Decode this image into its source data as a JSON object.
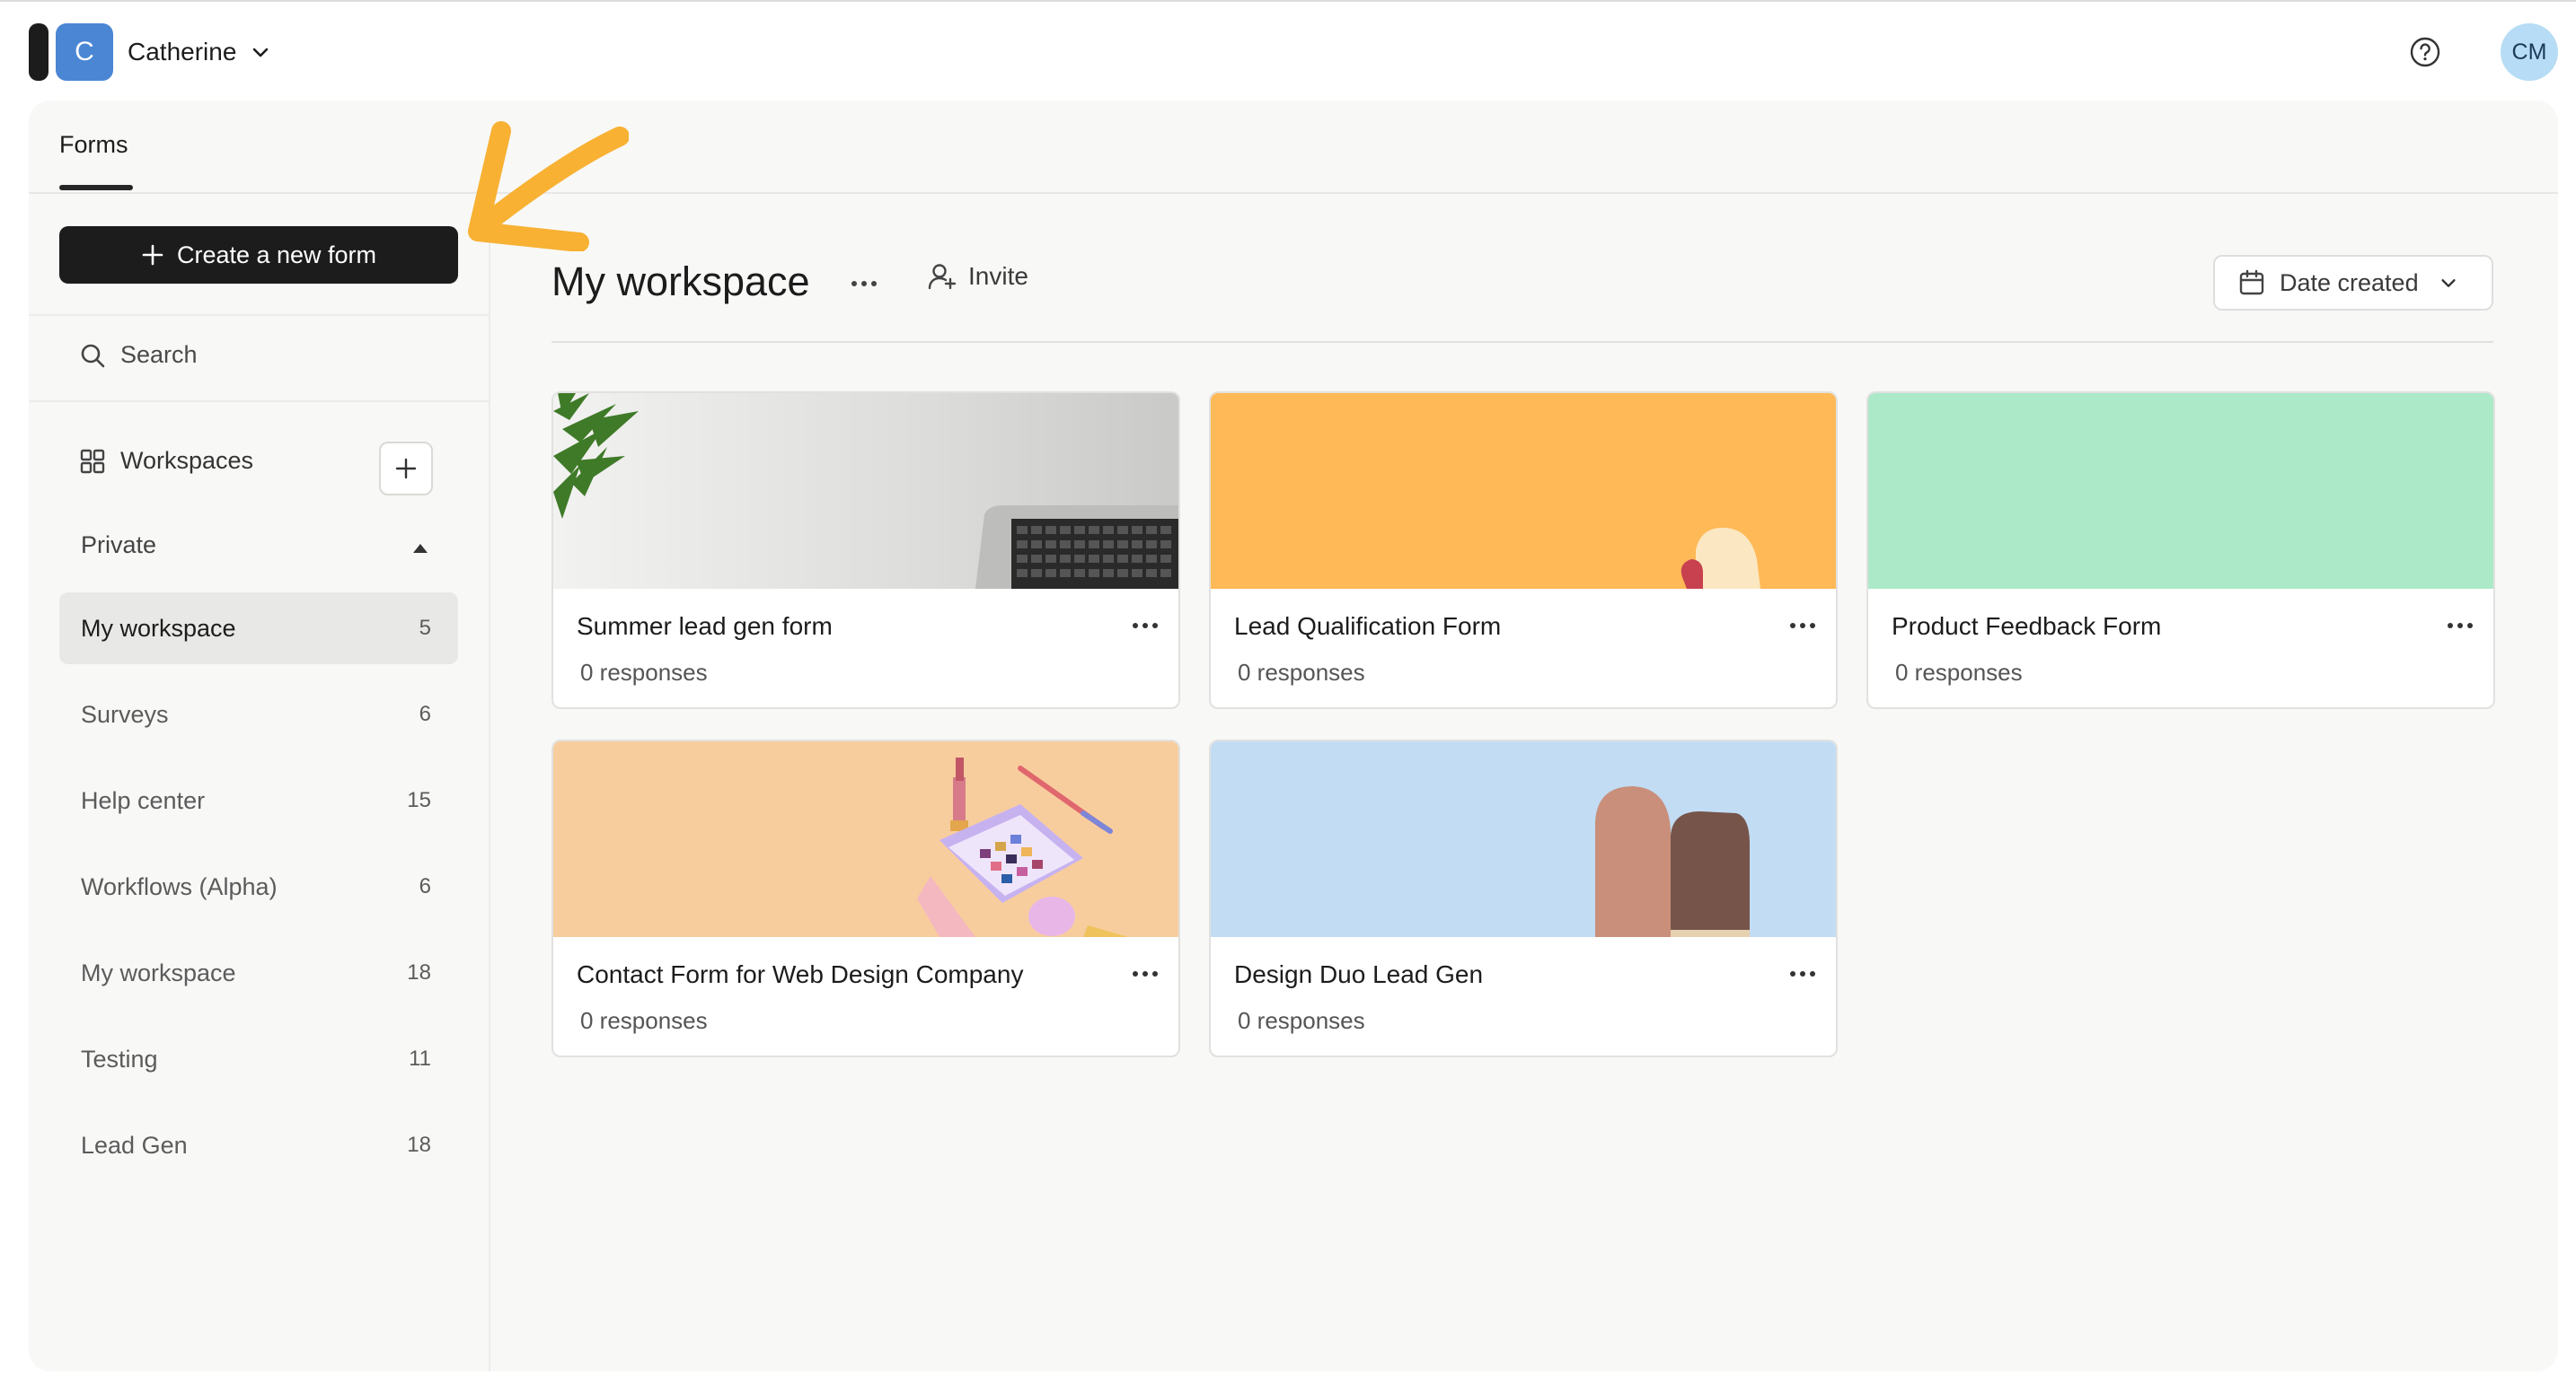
{
  "account": {
    "initial": "C",
    "name": "Catherine"
  },
  "user": {
    "initials": "CM"
  },
  "tabs": {
    "forms": "Forms"
  },
  "sidebar": {
    "create_label": "Create a new form",
    "search_label": "Search",
    "workspaces_label": "Workspaces",
    "private_label": "Private",
    "items": [
      {
        "label": "My workspace",
        "count": "5",
        "active": true
      },
      {
        "label": "Surveys",
        "count": "6"
      },
      {
        "label": "Help center",
        "count": "15"
      },
      {
        "label": "Workflows (Alpha)",
        "count": "6"
      },
      {
        "label": "My workspace",
        "count": "18"
      },
      {
        "label": "Testing",
        "count": "11"
      },
      {
        "label": "Lead Gen",
        "count": "18"
      }
    ]
  },
  "main": {
    "title": "My workspace",
    "invite_label": "Invite",
    "sort_label": "Date created",
    "cards": [
      {
        "title": "Summer lead gen form",
        "responses": "0 responses",
        "thumb": "laptop-plant-photo",
        "color": "#e9e9e7"
      },
      {
        "title": "Lead Qualification Form",
        "responses": "0 responses",
        "thumb": "orange-illustration",
        "color": "#ffb957"
      },
      {
        "title": "Product Feedback Form",
        "responses": "0 responses",
        "thumb": "mint-solid",
        "color": "#abe9c8"
      },
      {
        "title": "Contact Form for Web Design Company",
        "responses": "0 responses",
        "thumb": "makeup-illustration",
        "color": "#f8cd9e"
      },
      {
        "title": "Design Duo Lead Gen",
        "responses": "0 responses",
        "thumb": "blue-illustration",
        "color": "#c2dcf3"
      }
    ]
  },
  "colors": {
    "accent_dark": "#1c1c1c",
    "arrow": "#f8b133",
    "avatar_blue": "#4a86d4",
    "user_avatar": "#b7dcf5"
  }
}
